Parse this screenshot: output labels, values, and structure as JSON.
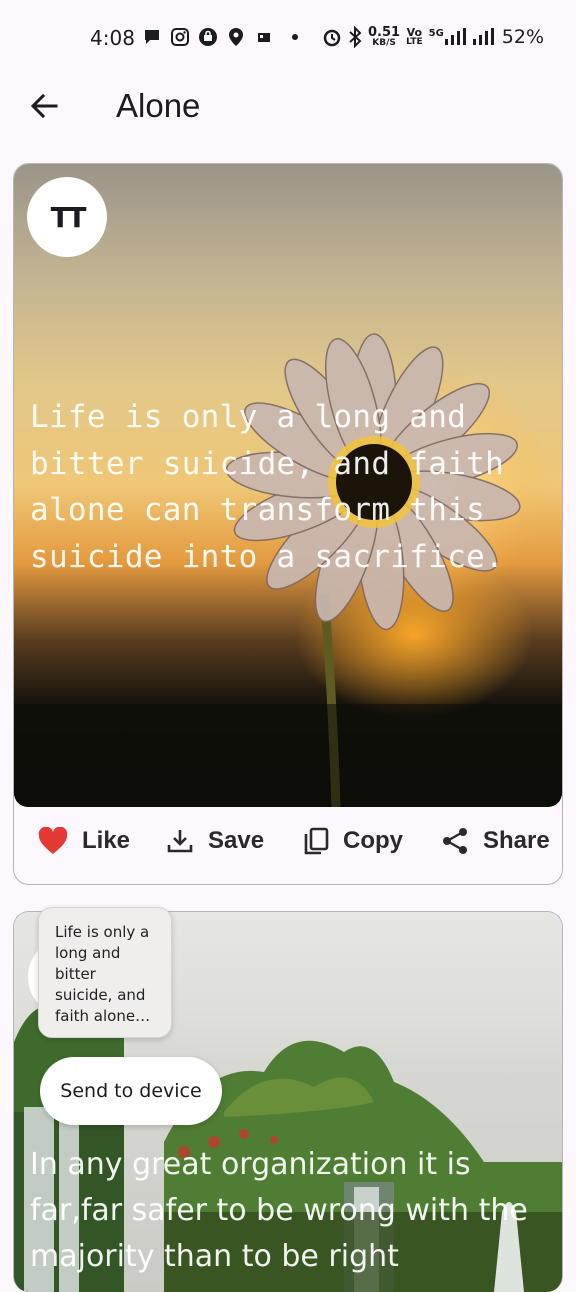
{
  "status_bar": {
    "time": "4:08",
    "net_speed_value": "0.51",
    "net_speed_unit": "KB/S",
    "volte_top": "Vo",
    "volte_bottom": "LTE",
    "network_5g": "5G",
    "battery": "52%"
  },
  "app_bar": {
    "title": "Alone"
  },
  "cards": [
    {
      "quote": "Life is only a long and bitter suicide, and faith alone can transform this suicide into a sacrifice.",
      "text_size_label": "TT",
      "actions": {
        "like": "Like",
        "save": "Save",
        "copy": "Copy",
        "share": "Share"
      }
    },
    {
      "quote": "In any great organization it is far,far safer to be wrong with the majority than to be right"
    }
  ],
  "overlay": {
    "preview_text": "Life is only a long and bitter suicide, and faith alone can t…",
    "send_label": "Send to device"
  },
  "colors": {
    "like_heart": "#e53935",
    "background": "#fdf8fd",
    "card_border": "#b9b4bc"
  }
}
